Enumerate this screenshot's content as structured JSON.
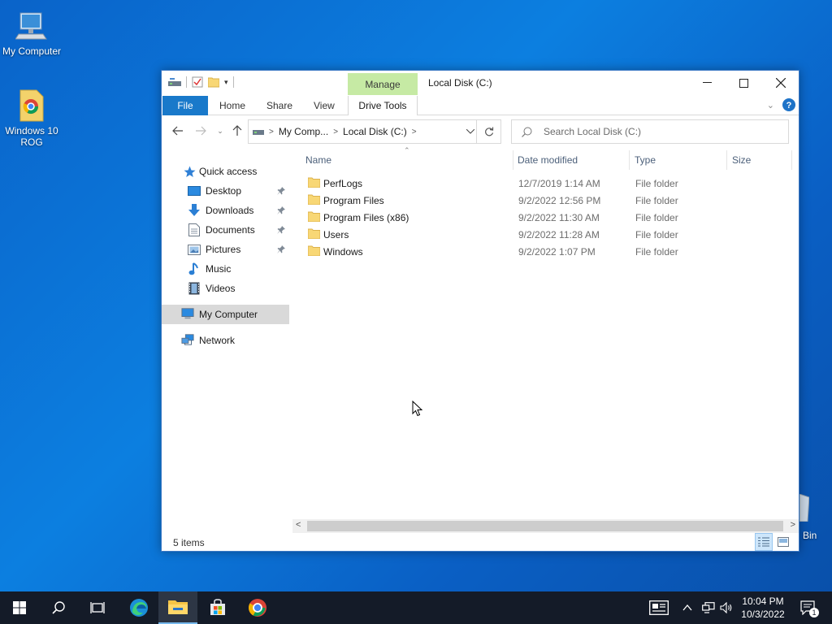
{
  "desktop": {
    "icons": [
      {
        "label": "My Computer"
      },
      {
        "label": "Windows 10 ROG"
      }
    ],
    "recycle_partial_label": "Bin"
  },
  "window": {
    "title": "Local Disk (C:)",
    "ribbon": {
      "context_group": "Manage",
      "tabs": [
        "File",
        "Home",
        "Share",
        "View",
        "Drive Tools"
      ]
    },
    "address": {
      "crumbs": [
        "My Comp...",
        "Local Disk (C:)"
      ]
    },
    "search": {
      "placeholder": "Search Local Disk (C:)"
    },
    "nav": {
      "quick_access": "Quick access",
      "items": [
        {
          "label": "Desktop",
          "pinned": true
        },
        {
          "label": "Downloads",
          "pinned": true
        },
        {
          "label": "Documents",
          "pinned": true
        },
        {
          "label": "Pictures",
          "pinned": true
        },
        {
          "label": "Music",
          "pinned": false
        },
        {
          "label": "Videos",
          "pinned": false
        }
      ],
      "this_pc": "My Computer",
      "network": "Network"
    },
    "columns": [
      "Name",
      "Date modified",
      "Type",
      "Size"
    ],
    "files": [
      {
        "name": "PerfLogs",
        "date": "12/7/2019 1:14 AM",
        "type": "File folder"
      },
      {
        "name": "Program Files",
        "date": "9/2/2022 12:56 PM",
        "type": "File folder"
      },
      {
        "name": "Program Files (x86)",
        "date": "9/2/2022 11:30 AM",
        "type": "File folder"
      },
      {
        "name": "Users",
        "date": "9/2/2022 11:28 AM",
        "type": "File folder"
      },
      {
        "name": "Windows",
        "date": "9/2/2022 1:07 PM",
        "type": "File folder"
      }
    ],
    "status": "5 items"
  },
  "taskbar": {
    "apps": [
      "start-icon",
      "search-icon",
      "task-view-icon",
      "edge-icon",
      "file-explorer-icon",
      "store-icon",
      "chrome-icon"
    ],
    "clock": {
      "time": "10:04 PM",
      "date": "10/3/2022"
    },
    "notification_count": "1"
  }
}
